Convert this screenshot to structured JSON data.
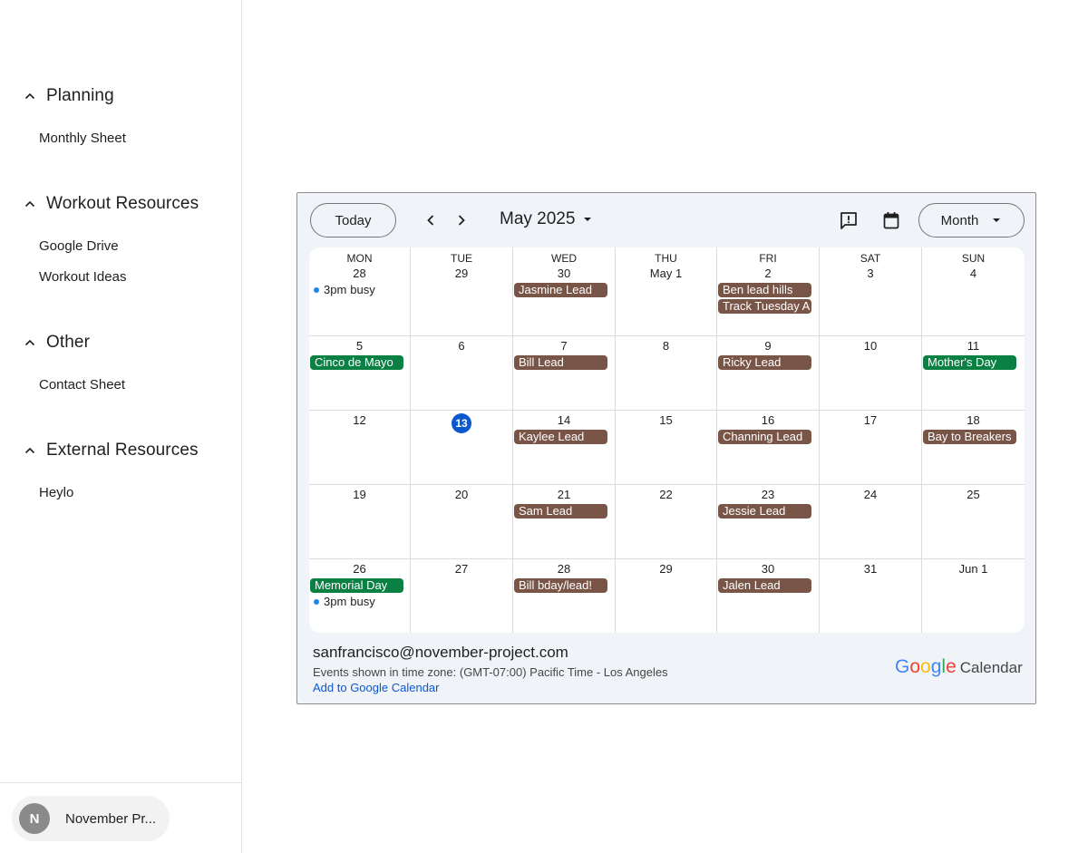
{
  "sidebar": {
    "sections": [
      {
        "title": "Planning",
        "links": [
          "Monthly Sheet"
        ]
      },
      {
        "title": "Workout Resources",
        "links": [
          "Google Drive",
          "Workout Ideas"
        ]
      },
      {
        "title": "Other",
        "links": [
          "Contact Sheet"
        ]
      },
      {
        "title": "External Resources",
        "links": [
          "Heylo"
        ]
      }
    ],
    "account": {
      "initial": "N",
      "name": "November Pr..."
    }
  },
  "calendar": {
    "today_label": "Today",
    "month_label": "May 2025",
    "view_label": "Month",
    "weekdays": [
      "MON",
      "TUE",
      "WED",
      "THU",
      "FRI",
      "SAT",
      "SUN"
    ],
    "weeks": [
      [
        "28",
        "29",
        "30",
        "May 1",
        "2",
        "3",
        "4"
      ],
      [
        "5",
        "6",
        "7",
        "8",
        "9",
        "10",
        "11"
      ],
      [
        "12",
        "13",
        "14",
        "15",
        "16",
        "17",
        "18"
      ],
      [
        "19",
        "20",
        "21",
        "22",
        "23",
        "24",
        "25"
      ],
      [
        "26",
        "27",
        "28",
        "29",
        "30",
        "31",
        "Jun 1"
      ]
    ],
    "today": {
      "week": 2,
      "day": 1
    },
    "events": [
      {
        "week": 0,
        "day": 0,
        "slot": 0,
        "kind": "timed",
        "time": "3pm",
        "title": "busy"
      },
      {
        "week": 0,
        "day": 2,
        "slot": 0,
        "kind": "allday",
        "color": "#795548",
        "title": "Jasmine Lead"
      },
      {
        "week": 0,
        "day": 4,
        "slot": 0,
        "kind": "allday",
        "color": "#795548",
        "title": "Ben lead hills"
      },
      {
        "week": 0,
        "day": 4,
        "slot": 1,
        "kind": "allday",
        "color": "#795548",
        "title": "Track Tuesday A"
      },
      {
        "week": 1,
        "day": 0,
        "slot": 0,
        "kind": "allday",
        "color": "#0b8043",
        "title": "Cinco de Mayo"
      },
      {
        "week": 1,
        "day": 2,
        "slot": 0,
        "kind": "allday",
        "color": "#795548",
        "title": "Bill Lead"
      },
      {
        "week": 1,
        "day": 4,
        "slot": 0,
        "kind": "allday",
        "color": "#795548",
        "title": "Ricky Lead"
      },
      {
        "week": 1,
        "day": 6,
        "slot": 0,
        "kind": "allday",
        "color": "#0b8043",
        "title": "Mother's Day"
      },
      {
        "week": 2,
        "day": 2,
        "slot": 0,
        "kind": "allday",
        "color": "#795548",
        "title": "Kaylee Lead"
      },
      {
        "week": 2,
        "day": 4,
        "slot": 0,
        "kind": "allday",
        "color": "#795548",
        "title": "Channing Lead"
      },
      {
        "week": 2,
        "day": 6,
        "slot": 0,
        "kind": "allday",
        "color": "#795548",
        "title": "Bay to Breakers"
      },
      {
        "week": 3,
        "day": 2,
        "slot": 0,
        "kind": "allday",
        "color": "#795548",
        "title": "Sam Lead"
      },
      {
        "week": 3,
        "day": 4,
        "slot": 0,
        "kind": "allday",
        "color": "#795548",
        "title": "Jessie Lead"
      },
      {
        "week": 4,
        "day": 0,
        "slot": 0,
        "kind": "allday",
        "color": "#0b8043",
        "title": "Memorial Day"
      },
      {
        "week": 4,
        "day": 0,
        "slot": 1,
        "kind": "timed",
        "time": "3pm",
        "title": "busy"
      },
      {
        "week": 4,
        "day": 2,
        "slot": 0,
        "kind": "allday",
        "color": "#795548",
        "title": "Bill bday/lead!"
      },
      {
        "week": 4,
        "day": 4,
        "slot": 0,
        "kind": "allday",
        "color": "#795548",
        "title": "Jalen Lead"
      }
    ],
    "footer": {
      "email": "sanfrancisco@november-project.com",
      "timezone": "Events shown in time zone: (GMT-07:00) Pacific Time - Los Angeles",
      "add_link": "Add to Google Calendar",
      "brand_google": "Google",
      "brand_calendar": "Calendar"
    },
    "icons": {
      "prev": "chevron-left-icon",
      "next": "chevron-right-icon",
      "feedback": "feedback-icon",
      "calendar": "calendar-icon"
    }
  }
}
